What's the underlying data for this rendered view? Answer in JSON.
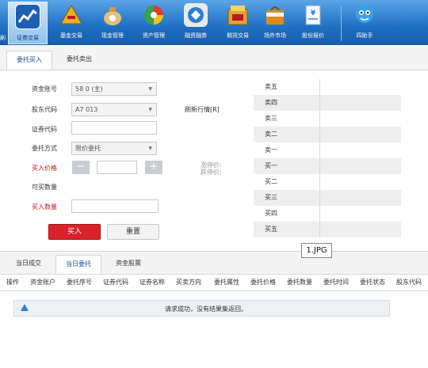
{
  "toolbar": {
    "items": [
      {
        "label": "证券交易",
        "icon": "stock-chart-icon",
        "color": "#1d5fb0"
      },
      {
        "label": "基金交易",
        "icon": "fund-pyramid-icon",
        "color": "#c98a14"
      },
      {
        "label": "现金管理",
        "icon": "money-bag-icon",
        "color": "#d9a441"
      },
      {
        "label": "资产管理",
        "icon": "pie-chart-icon",
        "color": "#3aa24a"
      },
      {
        "label": "融资融券",
        "icon": "margin-icon",
        "color": "#e9e9e9"
      },
      {
        "label": "期货交易",
        "icon": "futures-box-icon",
        "color": "#e1a23a"
      },
      {
        "label": "场外市场",
        "icon": "market-bag-icon",
        "color": "#e08a1a"
      },
      {
        "label": "股份报价",
        "icon": "yen-document-icon",
        "color": "#d7e6f5"
      },
      {
        "label": "四助手",
        "icon": "assistant-mascot-icon",
        "color": "#3aa0e6"
      }
    ],
    "partial_left_label": "刷"
  },
  "upper_tabs": [
    "委托买入",
    "委托卖出"
  ],
  "form": {
    "account_label": "资金账号",
    "account_value": "58       0 (主)",
    "holder_label": "股东代码",
    "holder_value": "A7       013",
    "code_label": "证券代码",
    "code_value": "",
    "method_label": "委托方式",
    "method_value": "限价委托",
    "price_label": "买入价格",
    "price_value": "",
    "minus_symbol": "−",
    "plus_symbol": "+",
    "can_buy_label": "可买数量",
    "qty_label": "买入数量",
    "qty_value": "",
    "refresh_label": "刷新行情[R]",
    "limit_up_label": "涨停价:",
    "limit_down_label": "跌停价:",
    "buy_button": "买入",
    "reset_button": "重置"
  },
  "order_book": [
    "卖五",
    "卖四",
    "卖三",
    "卖二",
    "卖一",
    "买一",
    "买二",
    "买三",
    "买四",
    "买五"
  ],
  "file_tag": "1.JPG",
  "lower_tabs": [
    "当日成交",
    "当日委托",
    "资金股票"
  ],
  "table_columns": [
    "操作",
    "资金账户",
    "委托序号",
    "证券代码",
    "证券名称",
    "买卖方向",
    "委托属性",
    "委托价格",
    "委托数量",
    "委托时间",
    "委托状态",
    "股东代码"
  ],
  "message": "请求成功，没有结果集返回。"
}
